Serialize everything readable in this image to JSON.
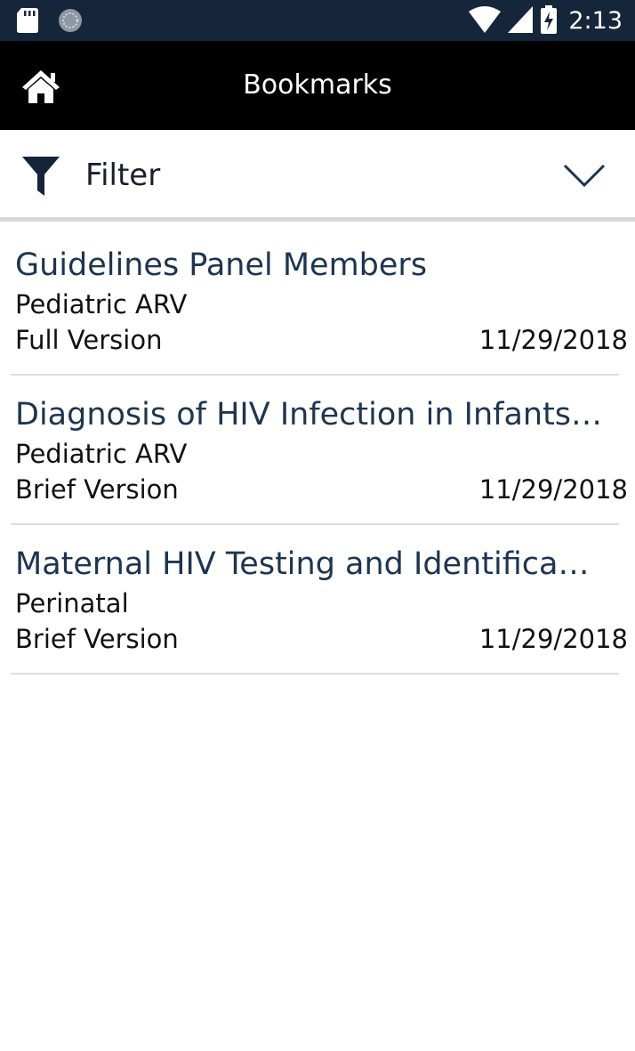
{
  "status_bar": {
    "left_icons": [
      "sd-card-icon",
      "sync-icon"
    ],
    "right_icons": [
      "wifi-icon",
      "cell-signal-icon",
      "battery-charging-icon"
    ],
    "time": "2:13"
  },
  "app_bar": {
    "home_icon": "home-icon",
    "title": "Bookmarks"
  },
  "filter": {
    "icon": "funnel-icon",
    "label": "Filter",
    "expand_icon": "chevron-down-icon"
  },
  "bookmarks": [
    {
      "title": "Guidelines Panel Members",
      "category": "Pediatric ARV",
      "version": "Full Version",
      "date": "11/29/2018"
    },
    {
      "title": "Diagnosis of HIV Infection in Infants…",
      "category": "Pediatric ARV",
      "version": "Brief Version",
      "date": "11/29/2018"
    },
    {
      "title": "Maternal HIV Testing and Identifica…",
      "category": "Perinatal",
      "version": "Brief Version",
      "date": "11/29/2018"
    }
  ],
  "colors": {
    "status_bar_bg": "#15263a",
    "app_bar_bg": "#000000",
    "title_text": "#1d3550",
    "divider": "#dddddd"
  }
}
